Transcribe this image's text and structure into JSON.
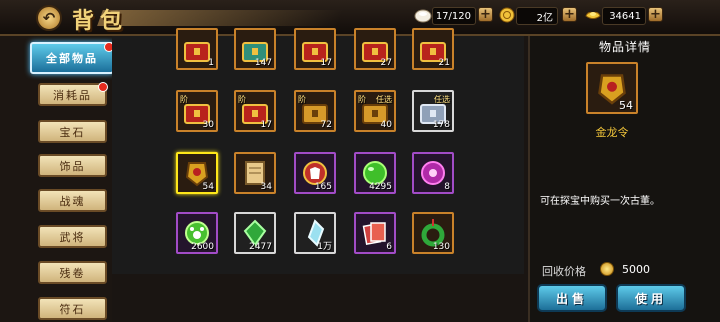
{
  "header": {
    "title": "背包",
    "back_icon": "back-arrow-icon",
    "resources": [
      {
        "icon": "bag-capacity-icon",
        "value": "17/120"
      },
      {
        "icon": "gold-coin-icon",
        "value": "2亿"
      },
      {
        "icon": "ingot-icon",
        "value": "34641"
      }
    ]
  },
  "sidebar": {
    "tabs": [
      "全部物品",
      "消耗品",
      "宝石",
      "饰品",
      "战魂",
      "武将",
      "残卷",
      "符石"
    ]
  },
  "grid": {
    "items": [
      {
        "icon": "red-treasure-chest-icon",
        "count": "1",
        "tag": "",
        "tag2": ""
      },
      {
        "icon": "jade-treasure-chest-icon",
        "count": "147",
        "tag": "",
        "tag2": ""
      },
      {
        "icon": "red-treasure-chest-icon",
        "count": "17",
        "tag": "",
        "tag2": ""
      },
      {
        "icon": "red-treasure-chest-icon",
        "count": "27",
        "tag": "",
        "tag2": ""
      },
      {
        "icon": "red-treasure-chest-icon",
        "count": "21",
        "tag": "",
        "tag2": ""
      },
      {
        "icon": "red-treasure-chest-icon",
        "count": "30",
        "tag": "阶",
        "tag2": ""
      },
      {
        "icon": "red-treasure-chest-icon",
        "count": "17",
        "tag": "阶",
        "tag2": ""
      },
      {
        "icon": "gold-treasure-chest-icon",
        "count": "72",
        "tag": "阶",
        "tag2": ""
      },
      {
        "icon": "gold-treasure-chest-icon",
        "count": "40",
        "tag": "阶",
        "tag2": "任选"
      },
      {
        "icon": "silver-treasure-chest-icon",
        "count": "178",
        "tag": "",
        "tag2": "任选"
      },
      {
        "icon": "golden-dragon-token-icon",
        "count": "54",
        "tag": "",
        "tag2": ""
      },
      {
        "icon": "scroll-icon",
        "count": "34",
        "tag": "",
        "tag2": ""
      },
      {
        "icon": "red-clothing-badge-icon",
        "count": "165",
        "tag": "",
        "tag2": ""
      },
      {
        "icon": "green-orb-icon",
        "count": "4295",
        "tag": "",
        "tag2": ""
      },
      {
        "icon": "purple-orb-icon",
        "count": "8",
        "tag": "",
        "tag2": ""
      },
      {
        "icon": "green-paw-orb-icon",
        "count": "2600",
        "tag": "",
        "tag2": ""
      },
      {
        "icon": "green-crystal-icon",
        "count": "2477",
        "tag": "",
        "tag2": ""
      },
      {
        "icon": "blue-crystal-icon",
        "count": "1万",
        "tag": "",
        "tag2": ""
      },
      {
        "icon": "red-cards-icon",
        "count": "6",
        "tag": "",
        "tag2": ""
      },
      {
        "icon": "jade-pendant-icon",
        "count": "130",
        "tag": "",
        "tag2": ""
      }
    ]
  },
  "detail": {
    "heading": "物品详情",
    "icon": "golden-dragon-token-icon",
    "count": "54",
    "name": "金龙令",
    "description": "可在探宝中购买一次古董。",
    "recycle_label": "回收价格",
    "recycle_icon": "gold-coin-icon",
    "recycle_value": "5000",
    "sell_label": "出售",
    "use_label": "使用"
  }
}
